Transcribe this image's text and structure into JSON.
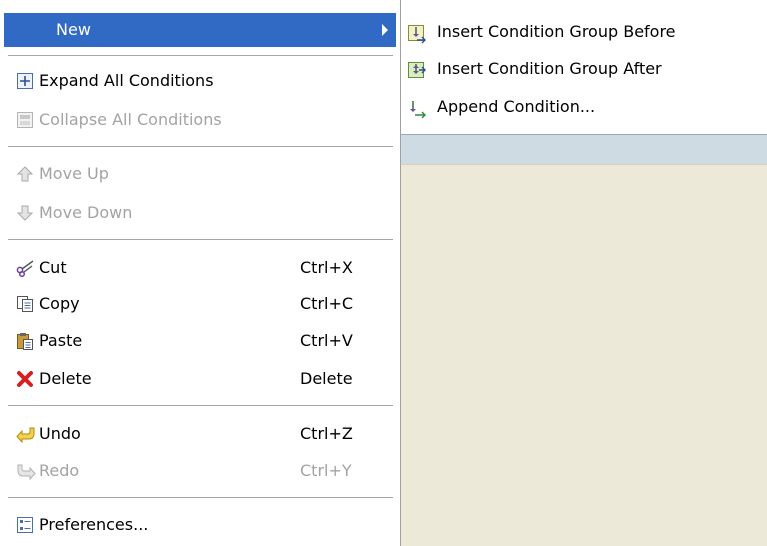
{
  "menu": {
    "items": [
      {
        "label": "New",
        "icon": "new-icon",
        "submenu": true,
        "highlighted": true
      },
      {
        "label": "Expand All Conditions",
        "icon": "expand-all-icon",
        "enabled": true
      },
      {
        "label": "Collapse All Conditions",
        "icon": "collapse-all-icon",
        "enabled": false
      },
      {
        "label": "Move Up",
        "icon": "arrow-up-icon",
        "enabled": false
      },
      {
        "label": "Move Down",
        "icon": "arrow-down-icon",
        "enabled": false
      },
      {
        "label": "Cut",
        "accelerator": "Ctrl+X",
        "icon": "scissors-icon",
        "enabled": true
      },
      {
        "label": "Copy",
        "accelerator": "Ctrl+C",
        "icon": "copy-icon",
        "enabled": true
      },
      {
        "label": "Paste",
        "accelerator": "Ctrl+V",
        "icon": "paste-icon",
        "enabled": true
      },
      {
        "label": "Delete",
        "accelerator": "Delete",
        "icon": "delete-icon",
        "enabled": true
      },
      {
        "label": "Undo",
        "accelerator": "Ctrl+Z",
        "icon": "undo-icon",
        "enabled": true
      },
      {
        "label": "Redo",
        "accelerator": "Ctrl+Y",
        "icon": "redo-icon",
        "enabled": false
      },
      {
        "label": "Preferences...",
        "icon": "preferences-icon",
        "enabled": true
      }
    ]
  },
  "submenu": {
    "items": [
      {
        "label": "Insert Condition Group Before",
        "icon": "insert-group-before-icon"
      },
      {
        "label": "Insert Condition Group After",
        "icon": "insert-group-after-icon"
      },
      {
        "label": "Append Condition...",
        "icon": "append-condition-icon"
      }
    ]
  },
  "colors": {
    "highlight": "#316ac5",
    "disabled_text": "#a3a3a3",
    "menu_bg": "#ffffff",
    "window_bg": "#ece9d8",
    "delete_icon": "#d42020"
  }
}
